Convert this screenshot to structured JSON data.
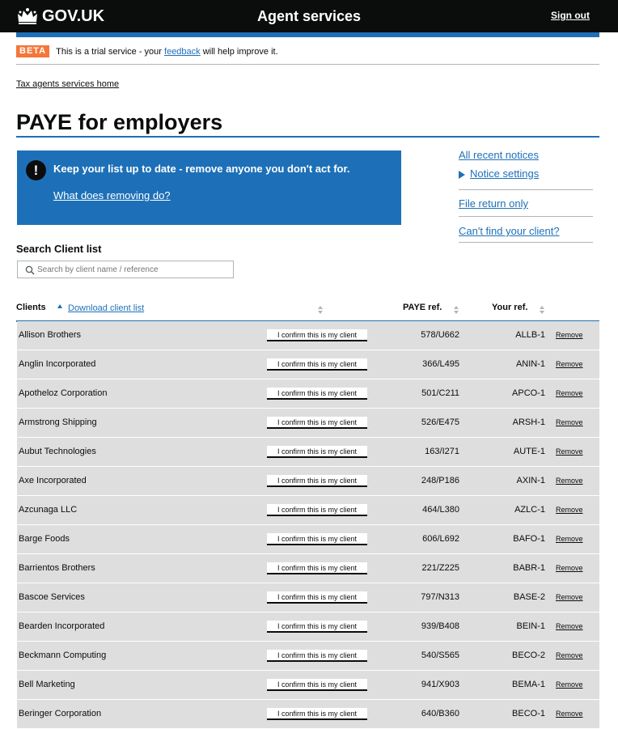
{
  "header": {
    "logo_text": "GOV.UK",
    "service_name": "Agent services",
    "sign_out": "Sign out"
  },
  "phase_banner": {
    "tag": "BETA",
    "text_before": "This is a trial service - your ",
    "link": "feedback",
    "text_after": " will help improve it."
  },
  "breadcrumb": "Tax agents services home",
  "page_title": "PAYE for employers",
  "notice": {
    "icon": "!",
    "text": "Keep your list up to date - remove anyone you don't act for.",
    "link": "What does removing do?"
  },
  "side_nav": {
    "all_notices": "All recent notices",
    "notice_settings": "Notice settings",
    "file_return": "File return only",
    "cant_find": "Can't find your client?"
  },
  "search": {
    "label": "Search Client list",
    "placeholder": "Search by client name / reference"
  },
  "table": {
    "headers": {
      "clients": "Clients",
      "download": "Download client list",
      "paye_ref": "PAYE ref.",
      "your_ref": "Your ref."
    },
    "confirm_label": "I confirm this is my client",
    "remove_label": "Remove",
    "rows": [
      {
        "name": "Allison Brothers",
        "paye": "578/U662",
        "ref": "ALLB-1"
      },
      {
        "name": "Anglin Incorporated",
        "paye": "366/L495",
        "ref": "ANIN-1"
      },
      {
        "name": "Apotheloz Corporation",
        "paye": "501/C211",
        "ref": "APCO-1"
      },
      {
        "name": "Armstrong Shipping",
        "paye": "526/E475",
        "ref": "ARSH-1"
      },
      {
        "name": "Aubut Technologies",
        "paye": "163/I271",
        "ref": "AUTE-1"
      },
      {
        "name": "Axe Incorporated",
        "paye": "248/P186",
        "ref": "AXIN-1"
      },
      {
        "name": "Azcunaga LLC",
        "paye": "464/L380",
        "ref": "AZLC-1"
      },
      {
        "name": "Barge Foods",
        "paye": "606/L692",
        "ref": "BAFO-1"
      },
      {
        "name": "Barrientos Brothers",
        "paye": "221/Z225",
        "ref": "BABR-1"
      },
      {
        "name": "Bascoe Services",
        "paye": "797/N313",
        "ref": "BASE-2"
      },
      {
        "name": "Bearden Incorporated",
        "paye": "939/B408",
        "ref": "BEIN-1"
      },
      {
        "name": "Beckmann Computing",
        "paye": "540/S565",
        "ref": "BECO-2"
      },
      {
        "name": "Bell Marketing",
        "paye": "941/X903",
        "ref": "BEMA-1"
      },
      {
        "name": "Beringer Corporation",
        "paye": "640/B360",
        "ref": "BECO-1"
      }
    ]
  }
}
